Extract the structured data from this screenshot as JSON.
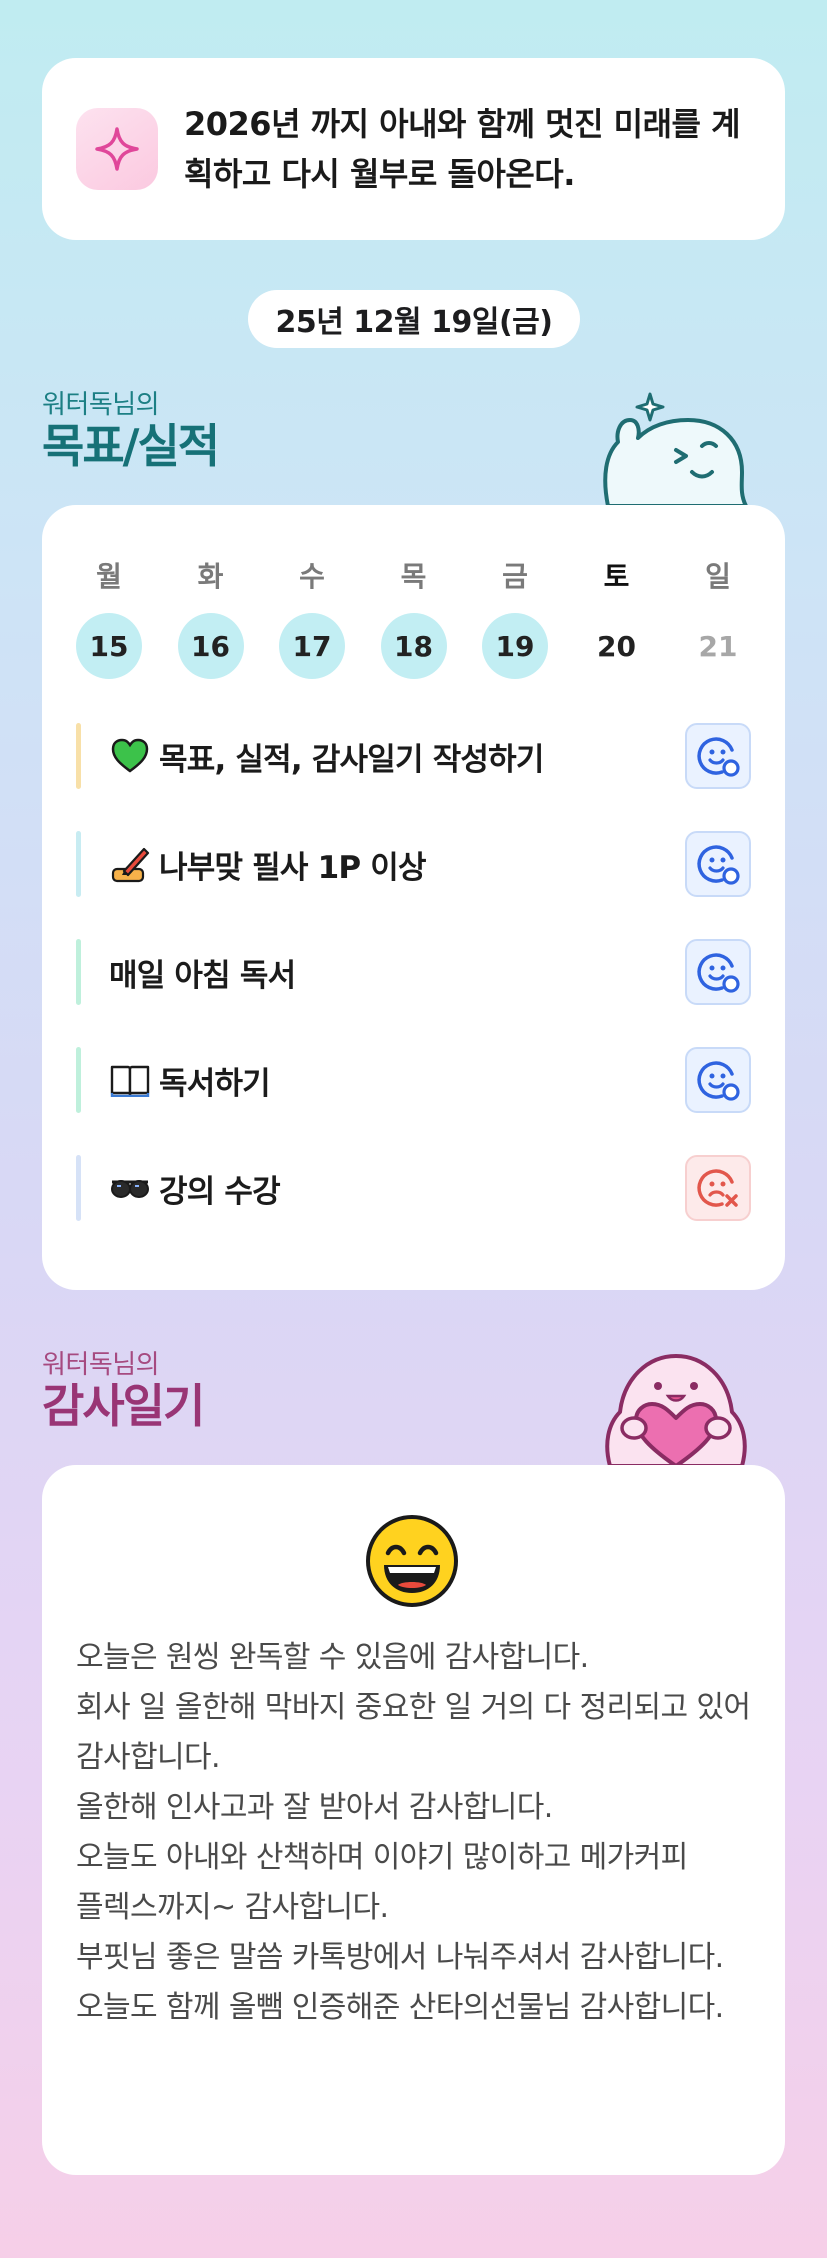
{
  "goal": {
    "icon": "sparkle-icon",
    "text": "2026년 까지 아내와 함께 멋진 미래를 계획하고 다시 월부로 돌아온다."
  },
  "date": "25년 12월 19일(금)",
  "goals_section": {
    "subtitle": "워터독님의",
    "title": "목표/실적",
    "mascot": "mascot-thumbs-up-icon"
  },
  "week": [
    {
      "name": "월",
      "day": "15",
      "state": "done"
    },
    {
      "name": "화",
      "day": "16",
      "state": "done"
    },
    {
      "name": "수",
      "day": "17",
      "state": "done"
    },
    {
      "name": "목",
      "day": "18",
      "state": "done"
    },
    {
      "name": "금",
      "day": "19",
      "state": "done"
    },
    {
      "name": "토",
      "day": "20",
      "state": "today"
    },
    {
      "name": "일",
      "day": "21",
      "state": "future"
    }
  ],
  "tasks": [
    {
      "label": "목표, 실적, 감사일기 작성하기",
      "emoji": "green-heart-icon",
      "bar_color": "#f8e0a8",
      "status": "smile-check-icon"
    },
    {
      "label": "나부맞 필사 1P 이상",
      "emoji": "writing-hand-icon",
      "bar_color": "#c8ecf2",
      "status": "smile-check-icon"
    },
    {
      "label": "매일 아침 독서",
      "emoji": "",
      "bar_color": "#bff0dc",
      "status": "smile-check-icon"
    },
    {
      "label": "독서하기",
      "emoji": "open-book-icon",
      "bar_color": "#bff0dc",
      "status": "smile-check-icon"
    },
    {
      "label": "강의 수강",
      "emoji": "sunglasses-icon",
      "bar_color": "#d6e2f7",
      "status": "frown-x-icon"
    }
  ],
  "colors": {
    "done_day": "#c2eef3",
    "status_ok": "#2f63e0",
    "status_no": "#e2574c",
    "teal_title": "#167177",
    "pink_title": "#993575"
  },
  "diary_section": {
    "subtitle": "워터독님의",
    "title": "감사일기",
    "mascot": "mascot-heart-icon"
  },
  "diary": {
    "mood": "grinning-face-icon",
    "text": "오늘은 원씽 완독할 수 있음에 감사합니다.\n회사 일 올한해 막바지 중요한 일 거의 다 정리되고 있어 감사합니다.\n올한해 인사고과 잘 받아서 감사합니다.\n오늘도 아내와 산책하며 이야기 많이하고 메가커피 플렉스까지~ 감사합니다.\n부핏님 좋은 말씀 카톡방에서 나눠주셔서 감사합니다.\n오늘도 함께 올뺌 인증해준 산타의선물님 감사합니다."
  }
}
